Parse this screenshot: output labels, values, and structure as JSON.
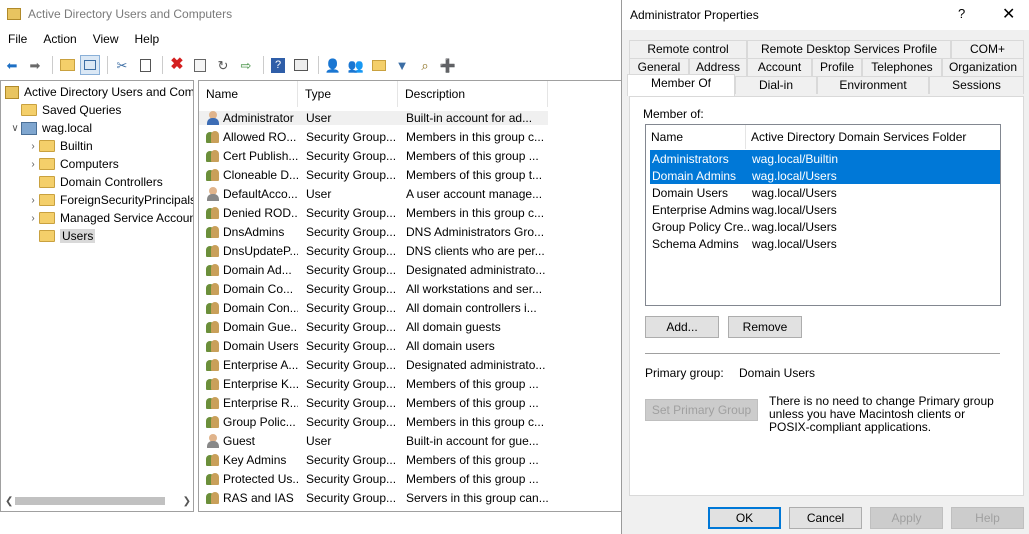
{
  "aduc": {
    "title": "Active Directory Users and Computers",
    "menu": [
      "File",
      "Action",
      "View",
      "Help"
    ],
    "toolbar_icons": [
      "back-icon",
      "forward-icon",
      "up-folder-icon",
      "show-tree-icon",
      "cut-icon",
      "copy-icon",
      "delete-icon",
      "properties-icon",
      "refresh-icon",
      "export-icon",
      "help-icon",
      "details-icon",
      "new-user-icon",
      "new-group-icon",
      "new-ou-icon",
      "filter-icon",
      "find-icon",
      "add-to-group-icon"
    ],
    "tree": {
      "root": "Active Directory Users and Com",
      "saved_queries": "Saved Queries",
      "domain": "wag.local",
      "children": [
        "Builtin",
        "Computers",
        "Domain Controllers",
        "ForeignSecurityPrincipals",
        "Managed Service Accoun",
        "Users"
      ]
    },
    "list": {
      "columns": [
        "Name",
        "Type",
        "Description"
      ],
      "rows": [
        {
          "name": "Administrator",
          "type": "User",
          "desc": "Built-in account for ad...",
          "icon": "user"
        },
        {
          "name": "Allowed RO...",
          "type": "Security Group...",
          "desc": "Members in this group c...",
          "icon": "group"
        },
        {
          "name": "Cert Publish...",
          "type": "Security Group...",
          "desc": "Members of this group ...",
          "icon": "group"
        },
        {
          "name": "Cloneable D...",
          "type": "Security Group...",
          "desc": "Members of this group t...",
          "icon": "group"
        },
        {
          "name": "DefaultAcco...",
          "type": "User",
          "desc": "A user account manage...",
          "icon": "user-disabled"
        },
        {
          "name": "Denied ROD...",
          "type": "Security Group...",
          "desc": "Members in this group c...",
          "icon": "group"
        },
        {
          "name": "DnsAdmins",
          "type": "Security Group...",
          "desc": "DNS Administrators Gro...",
          "icon": "group"
        },
        {
          "name": "DnsUpdateP...",
          "type": "Security Group...",
          "desc": "DNS clients who are per...",
          "icon": "group"
        },
        {
          "name": "Domain Ad...",
          "type": "Security Group...",
          "desc": "Designated administrato...",
          "icon": "group"
        },
        {
          "name": "Domain Co...",
          "type": "Security Group...",
          "desc": "All workstations and ser...",
          "icon": "group"
        },
        {
          "name": "Domain Con...",
          "type": "Security Group...",
          "desc": "All domain controllers i...",
          "icon": "group"
        },
        {
          "name": "Domain Gue...",
          "type": "Security Group...",
          "desc": "All domain guests",
          "icon": "group"
        },
        {
          "name": "Domain Users",
          "type": "Security Group...",
          "desc": "All domain users",
          "icon": "group"
        },
        {
          "name": "Enterprise A...",
          "type": "Security Group...",
          "desc": "Designated administrato...",
          "icon": "group"
        },
        {
          "name": "Enterprise K...",
          "type": "Security Group...",
          "desc": "Members of this group ...",
          "icon": "group"
        },
        {
          "name": "Enterprise R...",
          "type": "Security Group...",
          "desc": "Members of this group ...",
          "icon": "group"
        },
        {
          "name": "Group Polic...",
          "type": "Security Group...",
          "desc": "Members in this group c...",
          "icon": "group"
        },
        {
          "name": "Guest",
          "type": "User",
          "desc": "Built-in account for gue...",
          "icon": "user-disabled"
        },
        {
          "name": "Key Admins",
          "type": "Security Group...",
          "desc": "Members of this group ...",
          "icon": "group"
        },
        {
          "name": "Protected Us...",
          "type": "Security Group...",
          "desc": "Members of this group ...",
          "icon": "group"
        },
        {
          "name": "RAS and IAS ...",
          "type": "Security Group...",
          "desc": "Servers in this group can...",
          "icon": "group"
        }
      ]
    }
  },
  "dialog": {
    "title": "Administrator Properties",
    "help": "?",
    "close": "✕",
    "tabs_row1": [
      "Remote control",
      "Remote Desktop Services Profile",
      "COM+"
    ],
    "tabs_row2": [
      "General",
      "Address",
      "Account",
      "Profile",
      "Telephones",
      "Organization"
    ],
    "tabs_row3": [
      "Member Of",
      "Dial-in",
      "Environment",
      "Sessions"
    ],
    "member_of_label": "Member of:",
    "member_columns": [
      "Name",
      "Active Directory Domain Services Folder"
    ],
    "members": [
      {
        "name": "Administrators",
        "folder": "wag.local/Builtin",
        "selected": true
      },
      {
        "name": "Domain Admins",
        "folder": "wag.local/Users",
        "selected": true
      },
      {
        "name": "Domain Users",
        "folder": "wag.local/Users",
        "selected": false
      },
      {
        "name": "Enterprise Admins",
        "folder": "wag.local/Users",
        "selected": false
      },
      {
        "name": "Group Policy Cre...",
        "folder": "wag.local/Users",
        "selected": false
      },
      {
        "name": "Schema Admins",
        "folder": "wag.local/Users",
        "selected": false
      }
    ],
    "add_label": "Add...",
    "remove_label": "Remove",
    "primary_group_label": "Primary group:",
    "primary_group_value": "Domain Users",
    "set_primary_label": "Set Primary Group",
    "note": "There is no need to change Primary group unless you have Macintosh clients or POSIX-compliant applications.",
    "ok_label": "OK",
    "cancel_label": "Cancel",
    "apply_label": "Apply",
    "help_label": "Help",
    "selection_color": "#0078d7"
  }
}
